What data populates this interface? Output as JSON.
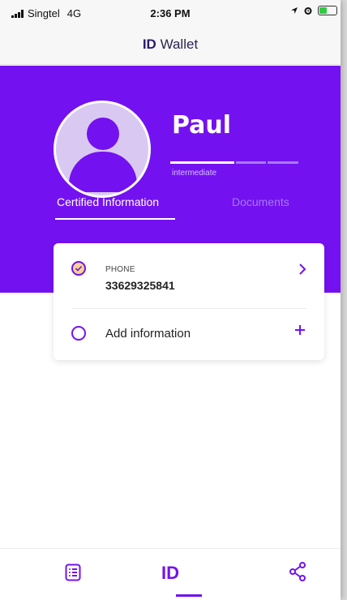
{
  "status_bar": {
    "carrier": "Singtel",
    "network": "4G",
    "time": "2:36 PM"
  },
  "nav": {
    "title_bold": "ID",
    "title_rest": "Wallet"
  },
  "profile": {
    "name": "Paul",
    "level_label": "intermediate",
    "level_progress_segments_filled": 1,
    "level_progress_segments_total": 3
  },
  "tabs": [
    {
      "label": "Certified Information",
      "active": true
    },
    {
      "label": "Documents",
      "active": false
    }
  ],
  "card": {
    "phone_label": "PHONE",
    "phone_value": "33629325841",
    "add_label": "Add information"
  },
  "bottom_bar": {
    "id_label": "ID"
  },
  "colors": {
    "accent": "#7411f0",
    "check_fill": "#f3d58a",
    "inactive_tab": "#a37af7"
  },
  "icons": [
    "list-icon",
    "share-icon",
    "chevron-right-icon",
    "plus-icon",
    "check-icon",
    "location-arrow-icon",
    "alarm-icon",
    "battery-icon",
    "signal-icon"
  ]
}
